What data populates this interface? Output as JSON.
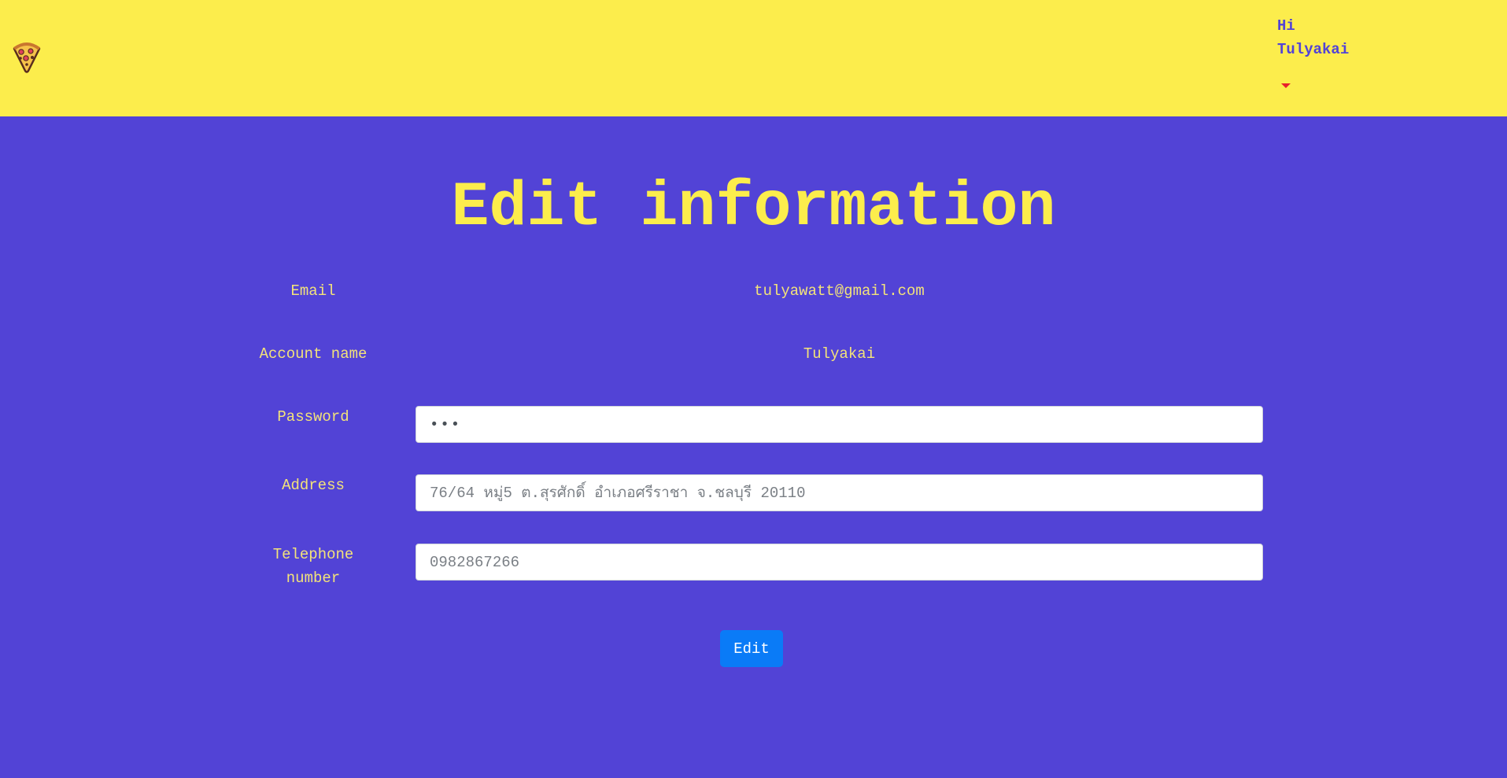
{
  "header": {
    "logo_icon": "pizza-icon",
    "greeting_line1": "Hi",
    "greeting_line2": "Tulyakai",
    "menu_icon": "caret-down-icon",
    "background_color": "#fced4c"
  },
  "page": {
    "title": "Edit information",
    "background_color": "#5243d6",
    "accent_color": "#fced4c"
  },
  "form": {
    "email_label": "Email",
    "email_value": "tulyawatt@gmail.com",
    "account_label": "Account name",
    "account_value": "Tulyakai",
    "password_label": "Password",
    "password_value": "•••",
    "address_label": "Address",
    "address_placeholder": "76/64 หมู่5 ต.สุรศักดิ์ อำเภอศรีราชา จ.ชลบุรี 20110",
    "telephone_label_line1": "Telephone",
    "telephone_label_line2": "number",
    "telephone_placeholder": "0982867266",
    "submit_label": "Edit",
    "submit_color": "#0a7bf7"
  }
}
